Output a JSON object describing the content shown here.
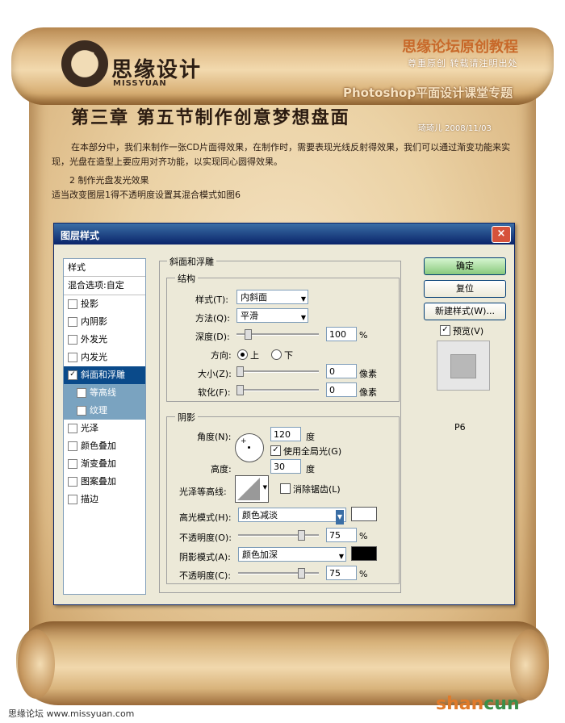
{
  "header": {
    "logo_text": "思缘设计",
    "logo_sub": "MISSYUAN",
    "site_title": "思缘论坛原创教程",
    "site_subtitle": "尊重原创  转载请注明出处",
    "topic": "Photoshop平面设计课堂专题"
  },
  "article": {
    "chapter_title": "第三章 第五节制作创意梦想盘面",
    "byline": "琦琦儿 2008/11/03",
    "paragraph": "在本部分中，我们来制作一张CD片面得效果，在制作时，需要表现光线反射得效果，我们可以通过渐变功能来实现，光盘在造型上要应用对齐功能，以实现同心圆得效果。",
    "subheading": "2 制作光盘发光效果",
    "note": "适当改变图层1得不透明度设置其混合模式如图6"
  },
  "dialog": {
    "title": "图层样式",
    "close": "×",
    "style_list": {
      "header": "样式",
      "blend": "混合选项:自定",
      "items": [
        {
          "label": "投影",
          "checked": false
        },
        {
          "label": "内阴影",
          "checked": false
        },
        {
          "label": "外发光",
          "checked": false
        },
        {
          "label": "内发光",
          "checked": false
        },
        {
          "label": "斜面和浮雕",
          "checked": true
        },
        {
          "label": "等高线",
          "checked": false
        },
        {
          "label": "纹理",
          "checked": false
        },
        {
          "label": "光泽",
          "checked": false
        },
        {
          "label": "颜色叠加",
          "checked": false
        },
        {
          "label": "渐变叠加",
          "checked": false
        },
        {
          "label": "图案叠加",
          "checked": false
        },
        {
          "label": "描边",
          "checked": false
        }
      ]
    },
    "bevel": {
      "group_title": "斜面和浮雕",
      "structure_title": "结构",
      "style_label": "样式(T):",
      "style_value": "内斜面",
      "technique_label": "方法(Q):",
      "technique_value": "平滑",
      "depth_label": "深度(D):",
      "depth_value": "100",
      "depth_unit": "%",
      "direction_label": "方向:",
      "direction_up": "上",
      "direction_down": "下",
      "size_label": "大小(Z):",
      "size_value": "0",
      "size_unit": "像素",
      "soften_label": "软化(F):",
      "soften_value": "0",
      "soften_unit": "像素"
    },
    "shading": {
      "title": "阴影",
      "angle_label": "角度(N):",
      "angle_value": "120",
      "angle_unit": "度",
      "global_light_label": "使用全局光(G)",
      "altitude_label": "高度:",
      "altitude_value": "30",
      "altitude_unit": "度",
      "gloss_label": "光泽等高线:",
      "antialias_label": "消除锯齿(L)",
      "highlight_label": "高光模式(H):",
      "highlight_value": "颜色减淡",
      "highlight_color": "#ffffff",
      "opacity1_label": "不透明度(O):",
      "opacity1_value": "75",
      "opacity_unit": "%",
      "shadow_label": "阴影模式(A):",
      "shadow_value": "颜色加深",
      "shadow_color": "#000000",
      "opacity2_label": "不透明度(C):",
      "opacity2_value": "75"
    },
    "buttons": {
      "ok": "确定",
      "reset": "复位",
      "new_style": "新建样式(W)...",
      "preview": "预览(V)"
    },
    "figure_label": "P6"
  },
  "footer": {
    "left": "思缘论坛  www.missyuan.com",
    "logo_a": "shan",
    "logo_b": "cun"
  }
}
